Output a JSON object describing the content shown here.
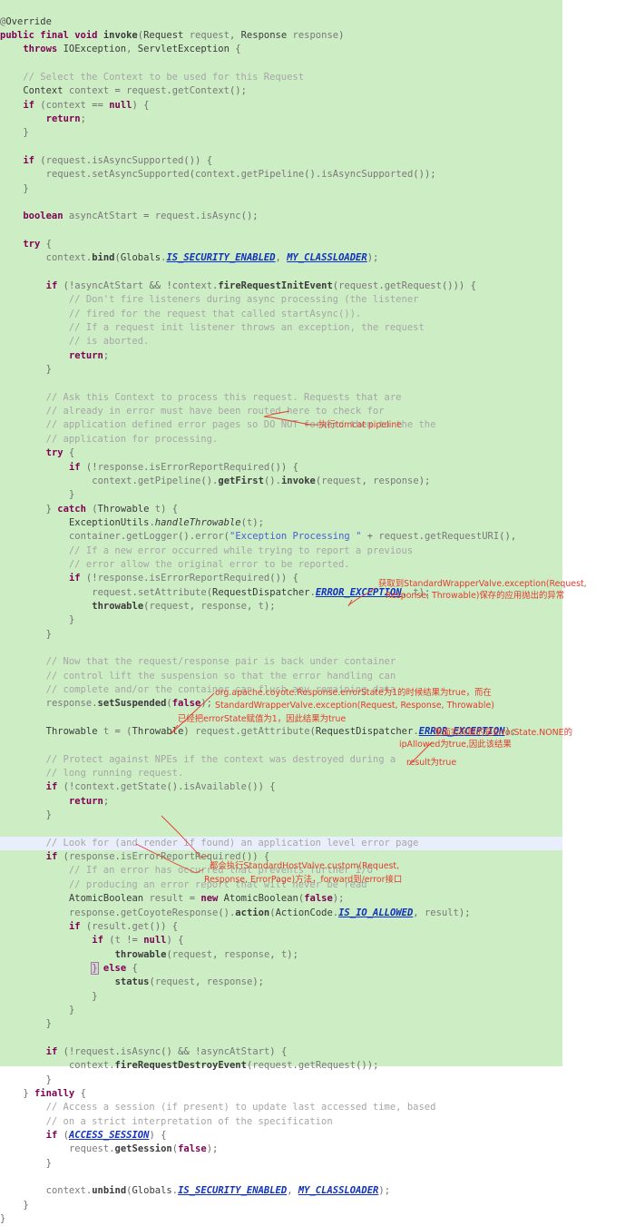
{
  "editor": {
    "background": "#cdedc4",
    "highlight_line_color": "#e8eefb",
    "annotation_color": "#e23b2e",
    "language": "java",
    "file_context": "StandardContextValve.invoke"
  },
  "code_lines": [
    "@Override",
    "public final void invoke(Request request, Response response)",
    "    throws IOException, ServletException {",
    "",
    "    // Select the Context to be used for this Request",
    "    Context context = request.getContext();",
    "    if (context == null) {",
    "        return;",
    "    }",
    "",
    "    if (request.isAsyncSupported()) {",
    "        request.setAsyncSupported(context.getPipeline().isAsyncSupported());",
    "    }",
    "",
    "    boolean asyncAtStart = request.isAsync();",
    "",
    "    try {",
    "        context.bind(Globals.IS_SECURITY_ENABLED, MY_CLASSLOADER);",
    "",
    "        if (!asyncAtStart && !context.fireRequestInitEvent(request.getRequest())) {",
    "            // Don't fire listeners during async processing (the listener",
    "            // fired for the request that called startAsync()).",
    "            // If a request init listener throws an exception, the request",
    "            // is aborted.",
    "            return;",
    "        }",
    "",
    "        // Ask this Context to process this request. Requests that are",
    "        // already in error must have been routed here to check for",
    "        // application defined error pages so DO NOT forward them to the the",
    "        // application for processing.",
    "        try {",
    "            if (!response.isErrorReportRequired()) {",
    "                context.getPipeline().getFirst().invoke(request, response);",
    "            }",
    "        } catch (Throwable t) {",
    "            ExceptionUtils.handleThrowable(t);",
    "            container.getLogger().error(\"Exception Processing \" + request.getRequestURI(),",
    "            // If a new error occurred while trying to report a previous",
    "            // error allow the original error to be reported.",
    "            if (!response.isErrorReportRequired()) {",
    "                request.setAttribute(RequestDispatcher.ERROR_EXCEPTION, t);",
    "                throwable(request, response, t);",
    "            }",
    "        }",
    "",
    "        // Now that the request/response pair is back under container",
    "        // control lift the suspension so that the error handling can",
    "        // complete and/or the container can flush any remaining data",
    "        response.setSuspended(false);",
    "",
    "        Throwable t = (Throwable) request.getAttribute(RequestDispatcher.ERROR_EXCEPTION);",
    "",
    "        // Protect against NPEs if the context was destroyed during a",
    "        // long running request.",
    "        if (!context.getState().isAvailable()) {",
    "            return;",
    "        }",
    "",
    "        // Look for (and render if found) an application level error page",
    "        if (response.isErrorReportRequired()) {",
    "            // If an error has occurred that prevents further I/O",
    "            // producing an error report that will never be read",
    "            AtomicBoolean result = new AtomicBoolean(false);",
    "            response.getCoyoteResponse().action(ActionCode.IS_IO_ALLOWED, result);",
    "            if (result.get()) {",
    "                if (t != null) {",
    "                    throwable(request, response, t);",
    "                } else {",
    "                    status(request, response);",
    "                }",
    "            }",
    "        }",
    "",
    "        if (!request.isAsync() && !asyncAtStart) {",
    "            context.fireRequestDestroyEvent(request.getRequest());",
    "        }",
    "    } finally {",
    "        // Access a session (if present) to update last accessed time, based",
    "        // on a strict interpretation of the specification",
    "        if (ACCESS_SESSION) {",
    "            request.getSession(false);",
    "        }",
    "",
    "        context.unbind(Globals.IS_SECURITY_ENABLED, MY_CLASSLOADER);",
    "    }",
    "}"
  ],
  "annotations": [
    {
      "id": "anno-tomcat-pipeline",
      "text": "执行tomcat pipeline"
    },
    {
      "id": "anno-wrappervalve-exception",
      "line1": "获取到StandardWrapperValve.exception(Request,",
      "line2": "Response, Throwable)保存的应用抛出的异常"
    },
    {
      "id": "anno-errorstate",
      "line1": "org.apache.coyote.Response.errorState为1的时候结果为true，而在",
      "line2": "StandardWrapperValve.exception(Request, Response, Throwable)",
      "line3": "已经把errorState赋值为1，因此结果为true"
    },
    {
      "id": "anno-errorstate-none",
      "line1": "里面实际取的是ErrorState.NONE的",
      "line2": "ipAllowed为true,因此该结果",
      "line3": "result为true"
    },
    {
      "id": "anno-hostvalve-custom",
      "line1": "都会执行StandardHostValve.custom(Request,",
      "line2": "Response, ErrorPage)方法，forward到/error接口"
    }
  ]
}
